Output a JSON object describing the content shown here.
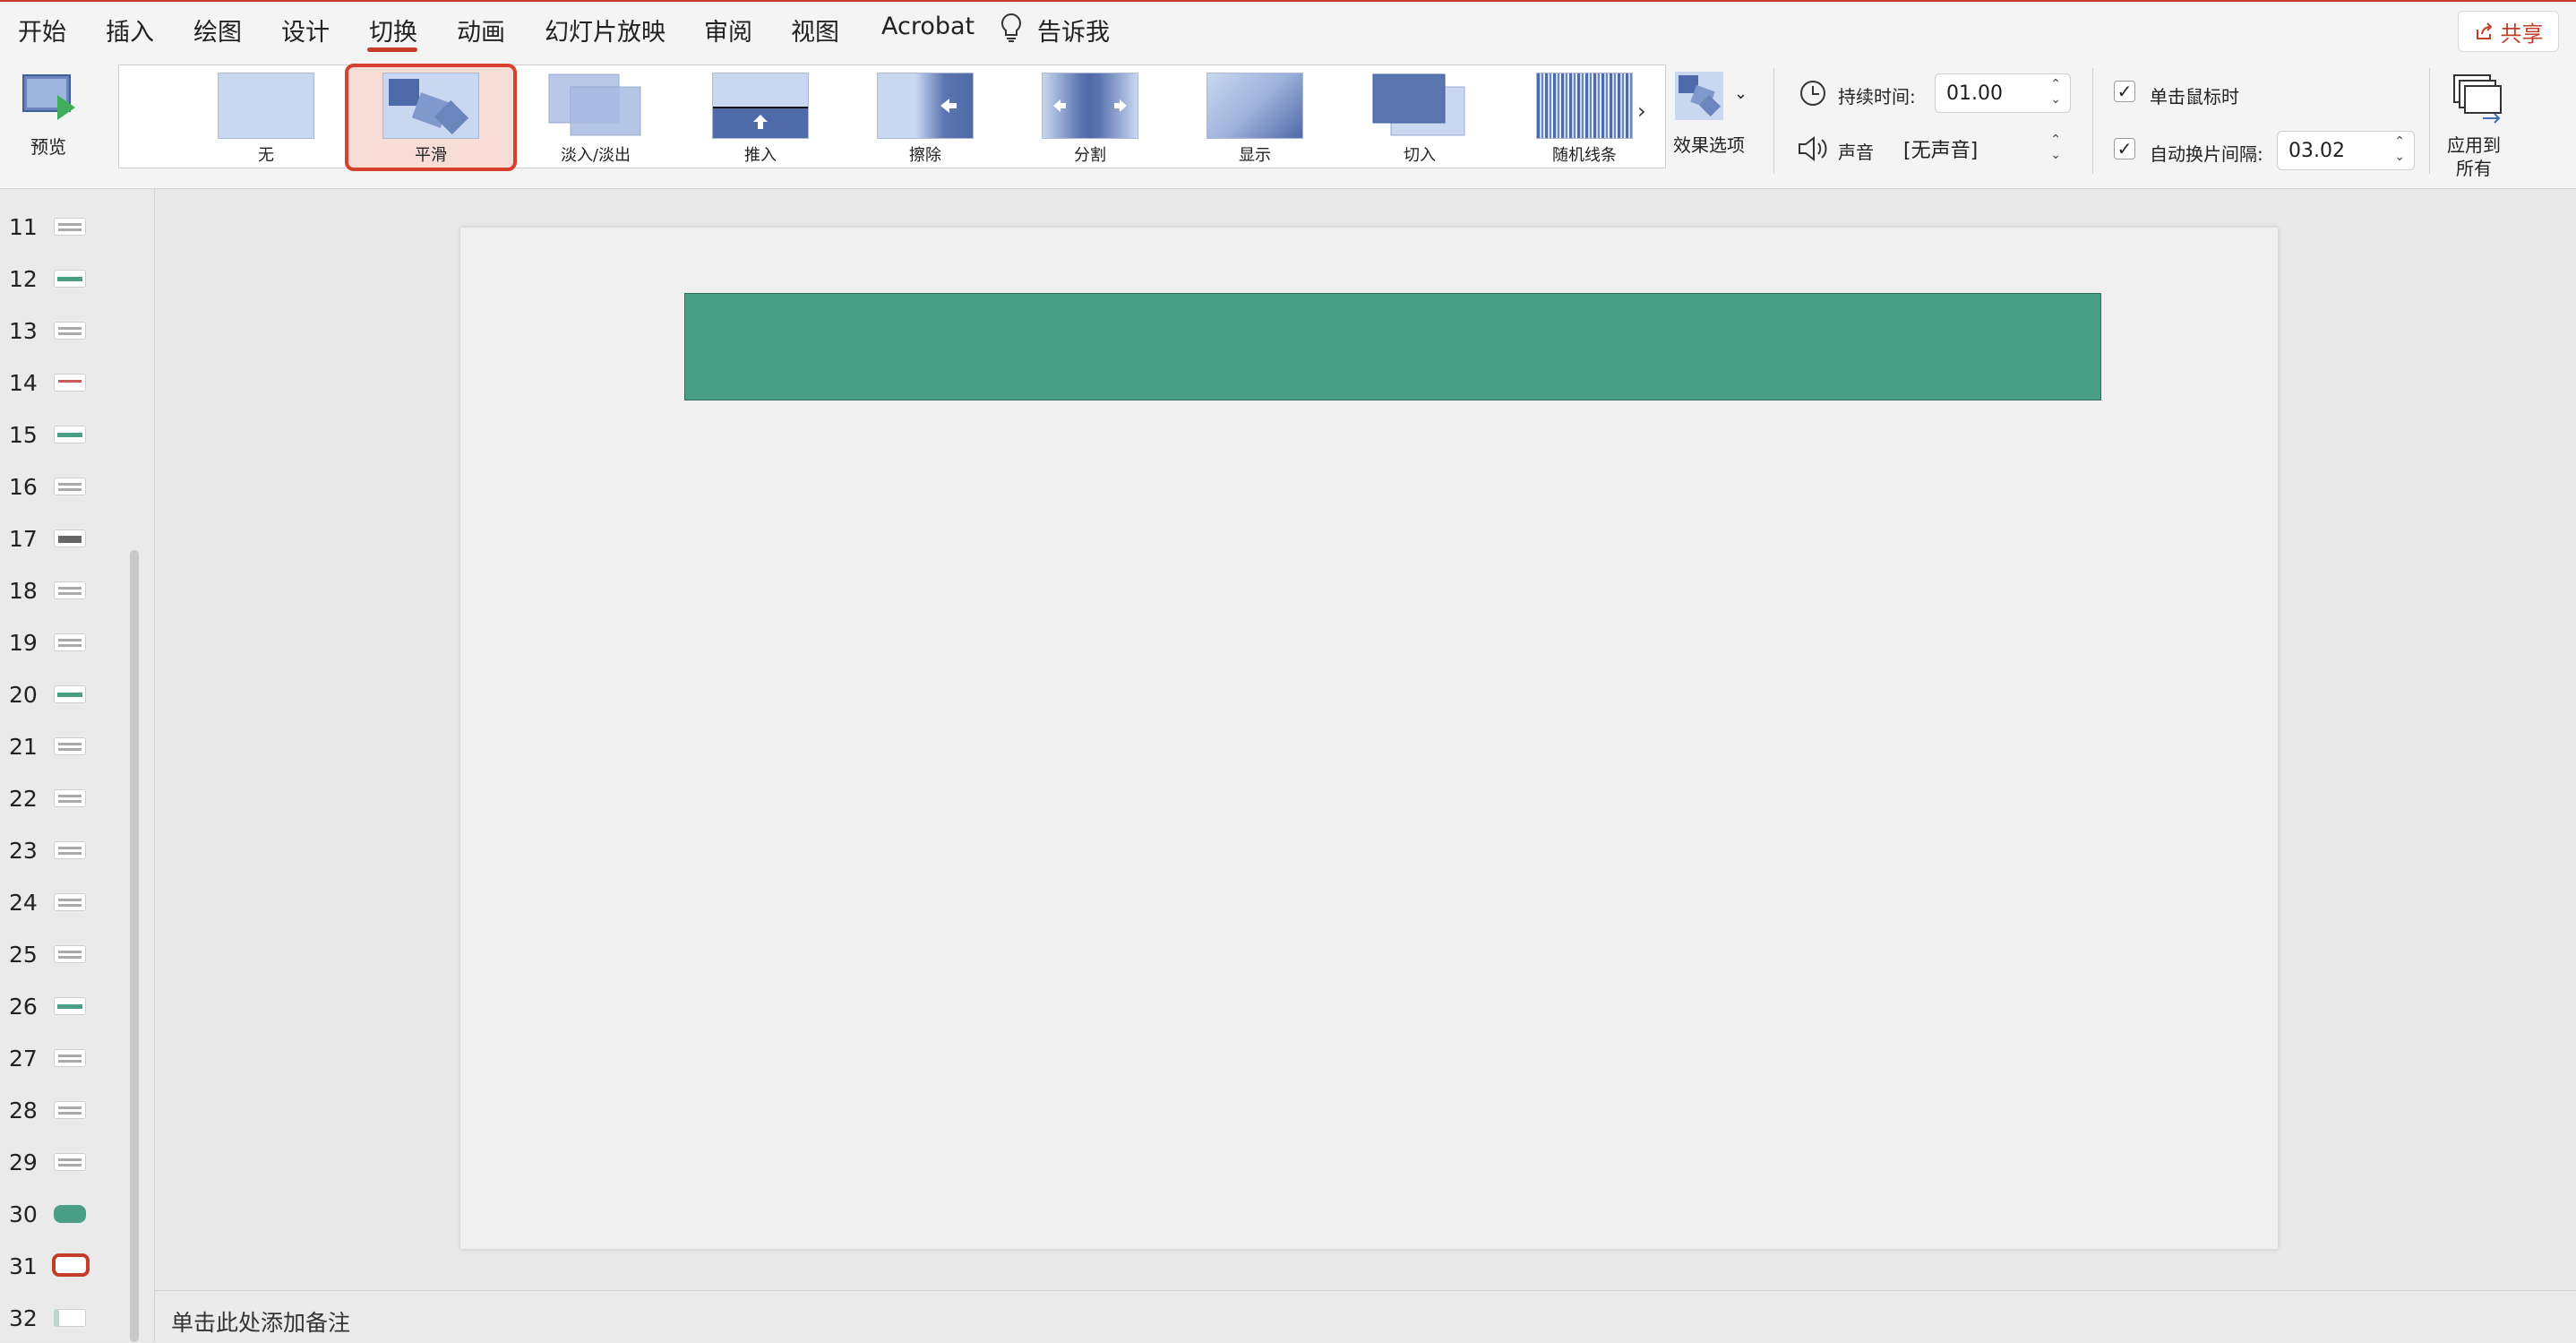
{
  "menu": {
    "tabs": [
      "开始",
      "插入",
      "绘图",
      "设计",
      "切换",
      "动画",
      "幻灯片放映",
      "审阅",
      "视图",
      "Acrobat"
    ],
    "active_tab": "切换",
    "tell_me": "告诉我",
    "share": "共享"
  },
  "ribbon": {
    "preview_label": "预览",
    "transitions": [
      "无",
      "平滑",
      "淡入/淡出",
      "推入",
      "擦除",
      "分割",
      "显示",
      "切入",
      "随机线条"
    ],
    "selected_transition": "平滑",
    "effect_options_label": "效果选项",
    "duration_label": "持续时间:",
    "duration_value": "01.00",
    "sound_label": "声音",
    "sound_value": "[无声音]",
    "on_click_label": "单击鼠标时",
    "on_click_checked": true,
    "auto_advance_label": "自动换片间隔:",
    "auto_advance_checked": true,
    "auto_advance_value": "03.02",
    "apply_all_line1": "应用到",
    "apply_all_line2": "所有"
  },
  "slides": {
    "numbers": [
      "11",
      "12",
      "13",
      "14",
      "15",
      "16",
      "17",
      "18",
      "19",
      "20",
      "21",
      "22",
      "23",
      "24",
      "25",
      "26",
      "27",
      "28",
      "29",
      "30",
      "31",
      "32"
    ],
    "selected": "31"
  },
  "canvas": {
    "title_shape_color": "#4a9e86"
  },
  "notes": {
    "placeholder": "单击此处添加备注"
  },
  "colors": {
    "accent": "#c43d29",
    "selection": "#d8402e",
    "thumb_blue": "#6b86bd"
  },
  "icons": [
    "lightbulb-icon",
    "share-icon",
    "preview-icon",
    "effect-options-icon",
    "clock-icon",
    "speaker-icon",
    "apply-all-icon",
    "chevron-right-icon",
    "chevron-down-icon",
    "checkmark-icon"
  ]
}
